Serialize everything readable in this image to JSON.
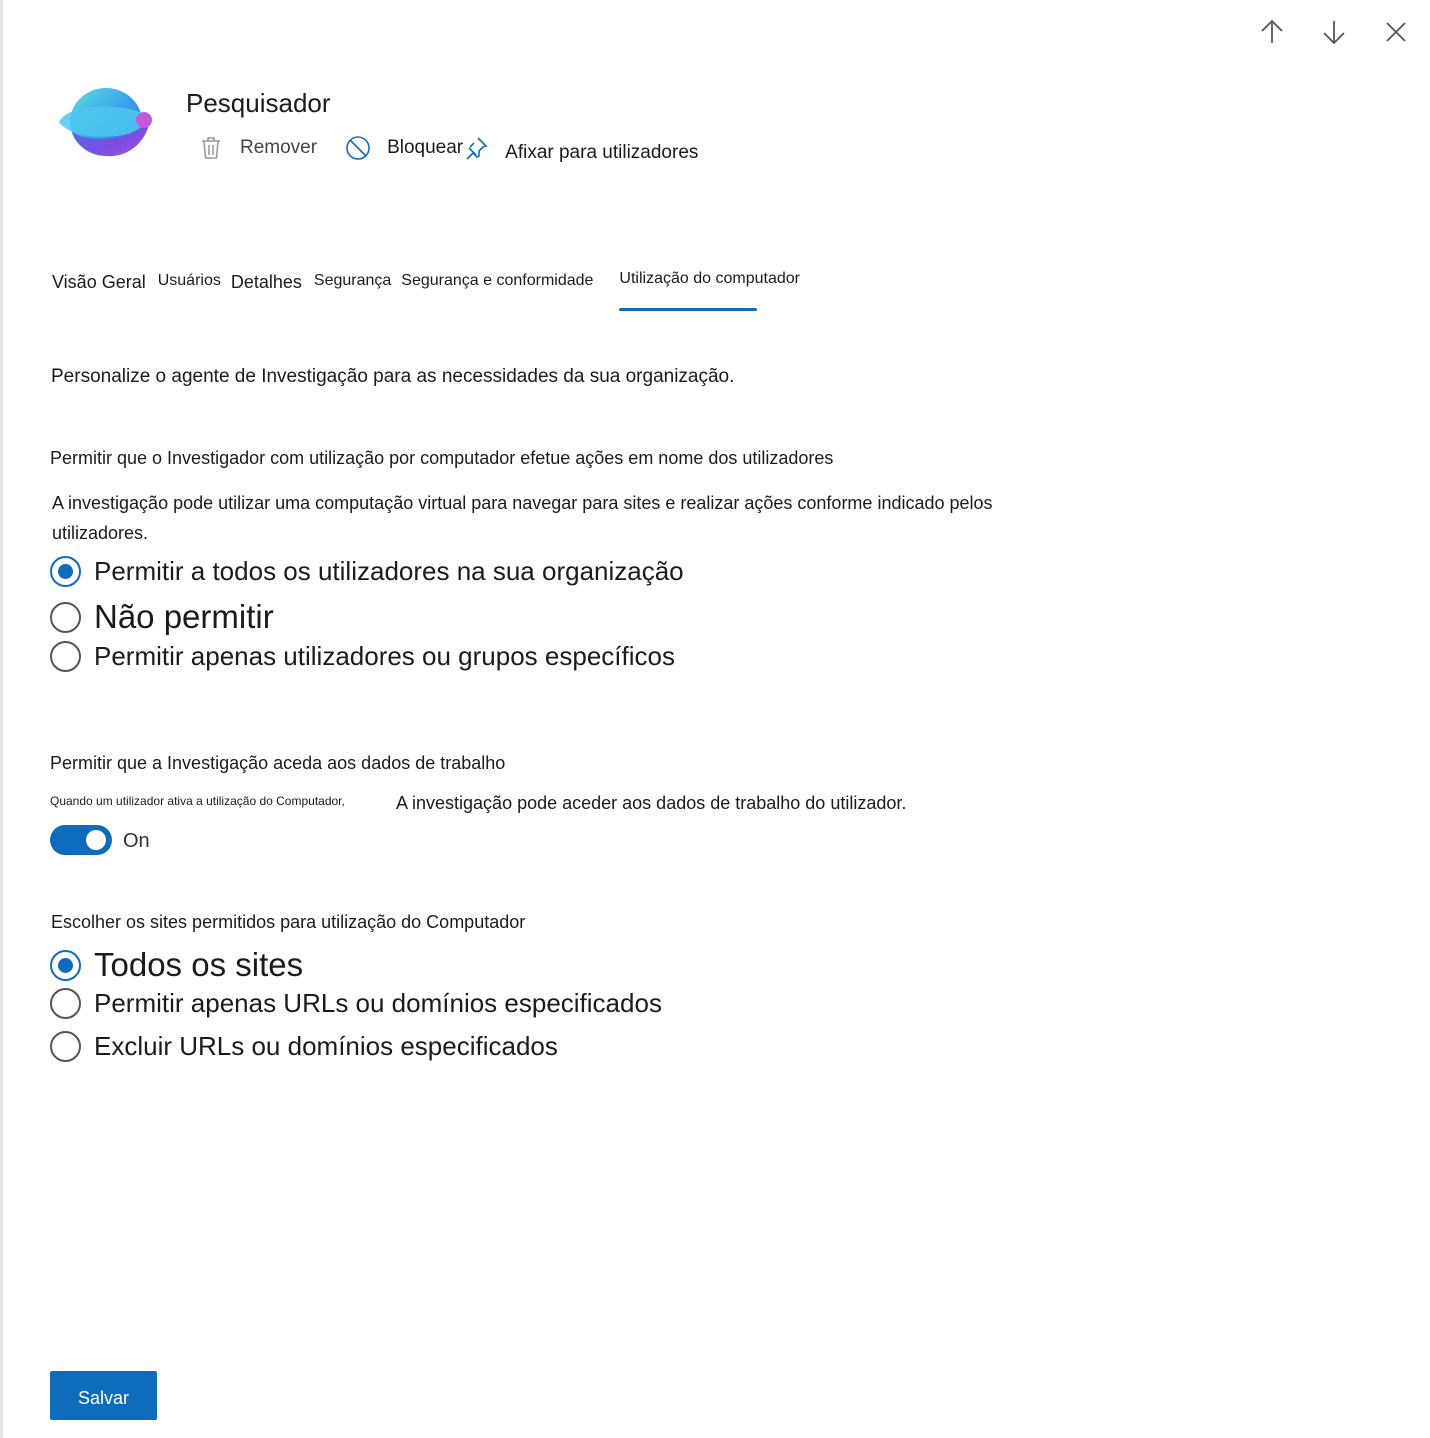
{
  "app": {
    "title": "Pesquisador",
    "logo": "researcher-logo"
  },
  "window_controls": {
    "previous": "arrow-up-icon",
    "next": "arrow-down-icon",
    "close": "close-icon"
  },
  "actions": {
    "remove_label": "Remover",
    "block_label": "Bloquear",
    "pin_label": "Afixar para utilizadores"
  },
  "tabs": [
    {
      "label": "Visão Geral"
    },
    {
      "label": "Usuários"
    },
    {
      "label": "Detalhes"
    },
    {
      "label": "Segurança"
    },
    {
      "label": "Segurança e conformidade"
    },
    {
      "label": "Utilização do computador",
      "active": true
    }
  ],
  "content": {
    "intro": "Personalize o agente de Investigação para as necessidades da sua organização.",
    "section1": {
      "title": "Permitir que o Investigador com utilização por computador efetue ações em nome dos utilizadores",
      "description": "A investigação pode utilizar uma computação virtual para navegar para sites e realizar ações conforme indicado pelos utilizadores.",
      "options": [
        {
          "label": "Permitir a todos os utilizadores na sua organização",
          "checked": true
        },
        {
          "label": "Não permitir",
          "checked": false
        },
        {
          "label": "Permitir apenas utilizadores ou grupos específicos",
          "checked": false
        }
      ]
    },
    "section2": {
      "title": "Permitir que a Investigação aceda aos dados de trabalho",
      "note": "Quando um utilizador ativa a utilização do Computador,",
      "description": "A investigação pode aceder aos dados de trabalho do utilizador.",
      "toggle_state": "On",
      "toggle_on": true
    },
    "section3": {
      "title": "Escolher os sites permitidos para utilização do Computador",
      "options": [
        {
          "label": "Todos os sites",
          "checked": true
        },
        {
          "label": "Permitir apenas URLs ou domínios especificados",
          "checked": false
        },
        {
          "label": "Excluir URLs ou domínios especificados",
          "checked": false
        }
      ]
    }
  },
  "footer": {
    "save_label": "Salvar"
  },
  "colors": {
    "accent": "#0f6cbd",
    "text": "#1b1b1b"
  }
}
